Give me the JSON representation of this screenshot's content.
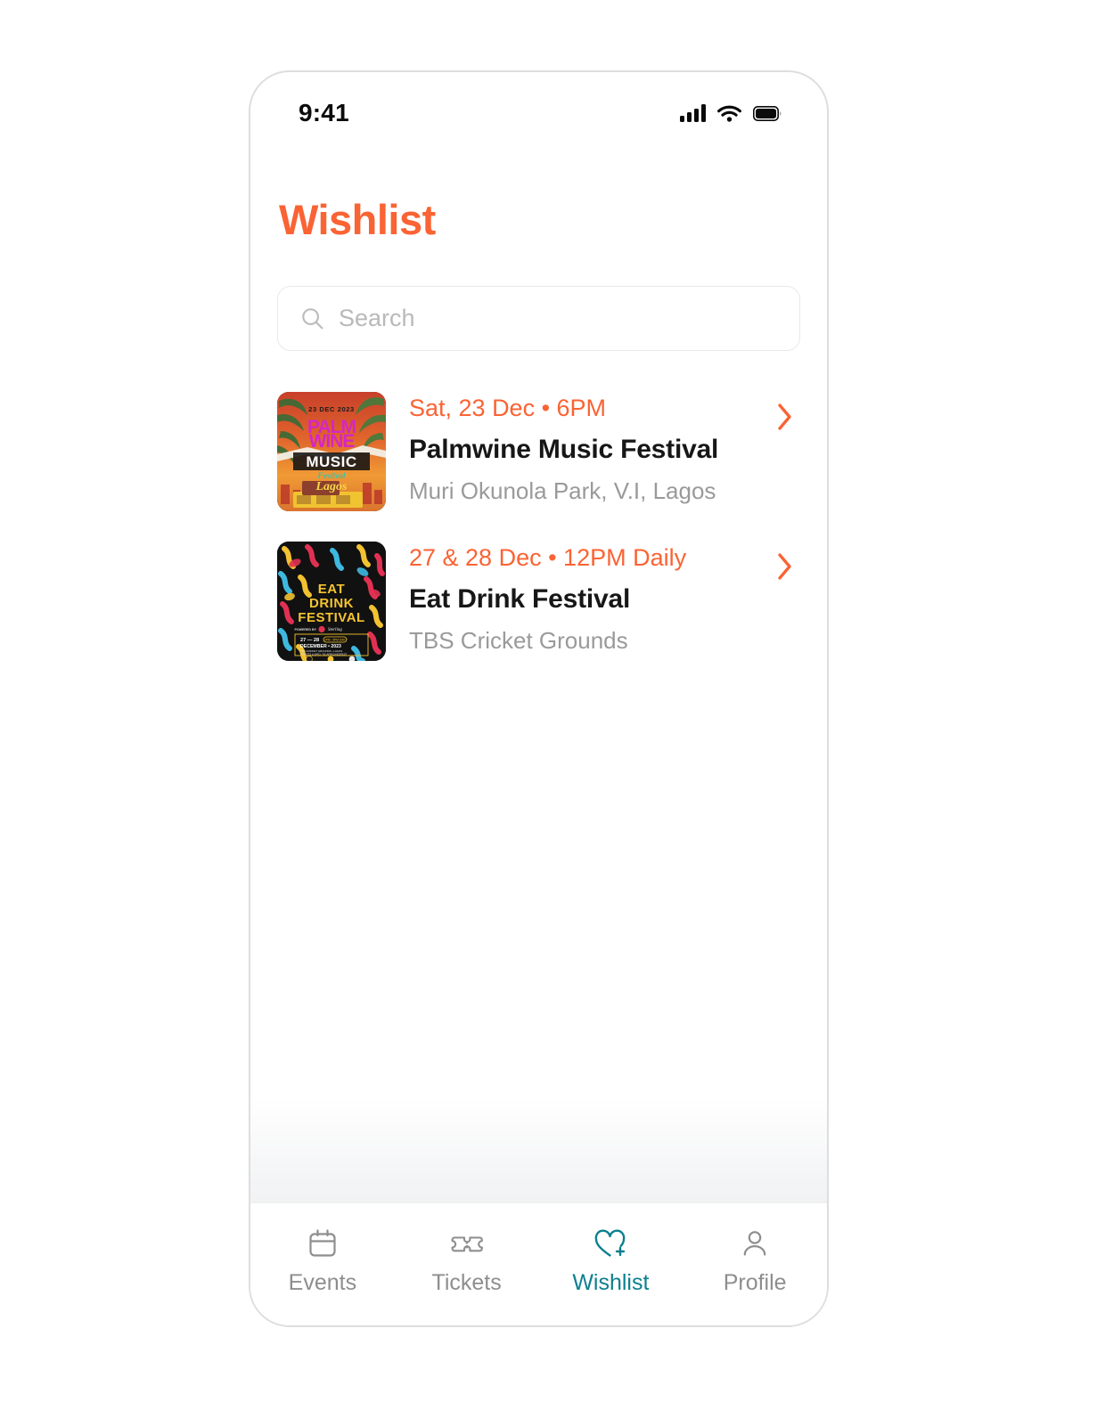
{
  "status_bar": {
    "time": "9:41",
    "signal_icon": "cellular-signal-icon",
    "wifi_icon": "wifi-icon",
    "battery_icon": "battery-icon"
  },
  "header": {
    "title": "Wishlist",
    "title_color": "#FA6334"
  },
  "search": {
    "placeholder": "Search",
    "value": "",
    "icon": "search-icon"
  },
  "events": [
    {
      "date": "Sat, 23 Dec • 6PM",
      "title": "Palmwine Music Festival",
      "venue": "Muri Okunola Park, V.I, Lagos",
      "chevron": "chevron-right-icon",
      "poster": {
        "name": "palmwine-music-festival-poster",
        "top_text": "23 DEC 2023",
        "line1": "PALMWINE",
        "line2": "MUSIC",
        "script": "Festival",
        "city": "Lagos"
      }
    },
    {
      "date": "27 & 28 Dec • 12PM Daily",
      "title": "Eat Drink Festival",
      "venue": "TBS Cricket Grounds",
      "chevron": "chevron-right-icon",
      "poster": {
        "name": "eat-drink-festival-poster",
        "line1": "EAT",
        "line2": "DRINK",
        "line3": "FESTIVAL",
        "sponsor": "POWERED BY Sterling",
        "info_dates": "27 — 28",
        "info_month": "DECEMBER  •  2023",
        "info_venue": "TBS CRICKET GROUNDS  •  LAGOS",
        "info_tickets": "TICKETS & INFO: TIX.AFRICA/EDFEST"
      }
    }
  ],
  "tabbar": {
    "active": "Wishlist",
    "active_color": "#0D7F8F",
    "inactive_color": "#8E8E8E",
    "items": [
      {
        "label": "Events",
        "icon": "calendar-icon"
      },
      {
        "label": "Tickets",
        "icon": "ticket-icon"
      },
      {
        "label": "Wishlist",
        "icon": "heart-plus-icon"
      },
      {
        "label": "Profile",
        "icon": "person-icon"
      }
    ]
  }
}
